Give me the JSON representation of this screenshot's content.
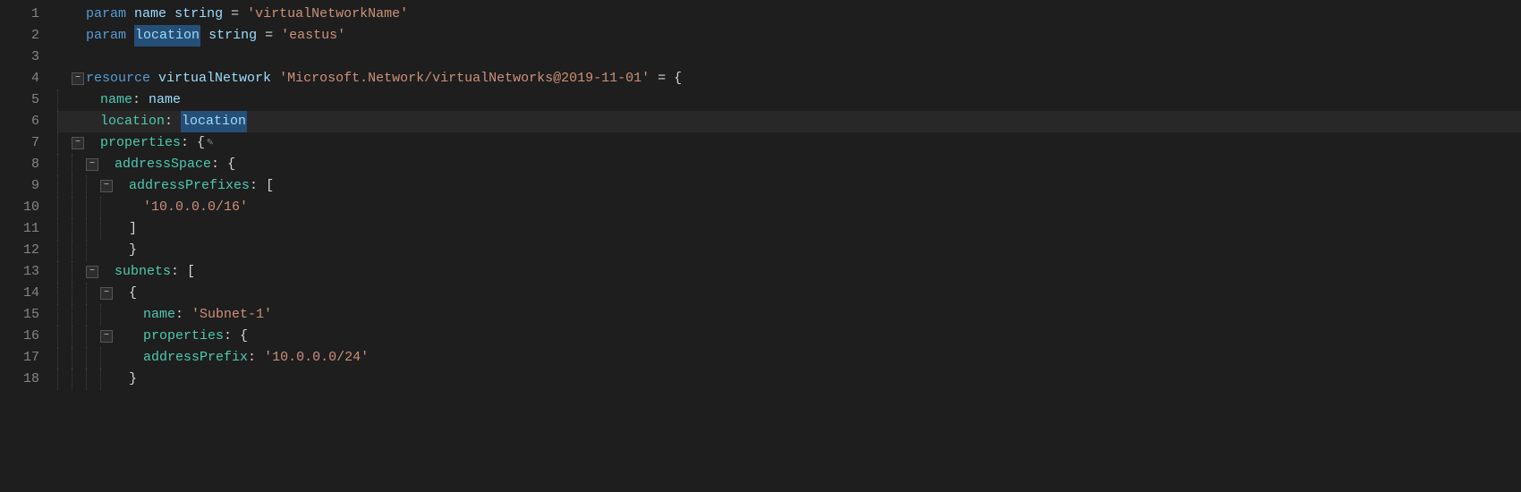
{
  "editor": {
    "background": "#1e1e1e",
    "lines": [
      {
        "number": "1",
        "content": "param_name_line",
        "indent": 1
      },
      {
        "number": "2",
        "content": "param_location_line",
        "indent": 1
      },
      {
        "number": "3",
        "content": "empty",
        "indent": 0
      },
      {
        "number": "4",
        "content": "resource_line",
        "indent": 1,
        "foldable": true
      },
      {
        "number": "5",
        "content": "name_property",
        "indent": 2
      },
      {
        "number": "6",
        "content": "location_property",
        "indent": 2,
        "active": true
      },
      {
        "number": "7",
        "content": "properties_line",
        "indent": 2,
        "foldable": true,
        "has_pencil": true
      },
      {
        "number": "8",
        "content": "addressspace_line",
        "indent": 3,
        "foldable": true
      },
      {
        "number": "9",
        "content": "addressprefixes_line",
        "indent": 4,
        "foldable": true
      },
      {
        "number": "10",
        "content": "prefix_value",
        "indent": 5
      },
      {
        "number": "11",
        "content": "close_bracket",
        "indent": 4
      },
      {
        "number": "12",
        "content": "close_brace_addressspace",
        "indent": 3
      },
      {
        "number": "13",
        "content": "subnets_line",
        "indent": 3,
        "foldable": true
      },
      {
        "number": "14",
        "content": "open_brace_subnet",
        "indent": 4,
        "foldable": true
      },
      {
        "number": "15",
        "content": "subnet_name",
        "indent": 5
      },
      {
        "number": "16",
        "content": "subnet_properties",
        "indent": 5,
        "foldable": true
      },
      {
        "number": "17",
        "content": "address_prefix",
        "indent": 6
      },
      {
        "number": "18",
        "content": "close_brace_subnet_props",
        "indent": 5
      }
    ],
    "tokens": {
      "kw_param": "param",
      "kw_resource": "resource",
      "name_identifier": "name",
      "location_identifier": "location",
      "string_virtualNetworkName": "'virtualNetworkName'",
      "string_eastus": "'eastus'",
      "type_string": "string",
      "resource_name": "virtualNetwork",
      "resource_type": "'Microsoft.Network/virtualNetworks@2019-11-01'",
      "eq": "=",
      "open_brace": "{",
      "close_brace": "}",
      "colon": ":",
      "prop_name": "name",
      "prop_location": "location",
      "prop_properties": "properties",
      "prop_addressspace": "addressSpace",
      "prop_addressprefixes": "addressPrefixes",
      "val_prefix": "'10.0.0.0/16'",
      "prop_subnets": "subnets",
      "prop_subnet_name": "name",
      "val_subnet_name": "'Subnet-1'",
      "prop_subnet_properties": "properties",
      "prop_addressprefix": "addressPrefix",
      "val_addressprefix": "'10.0.0.0/24'"
    }
  }
}
